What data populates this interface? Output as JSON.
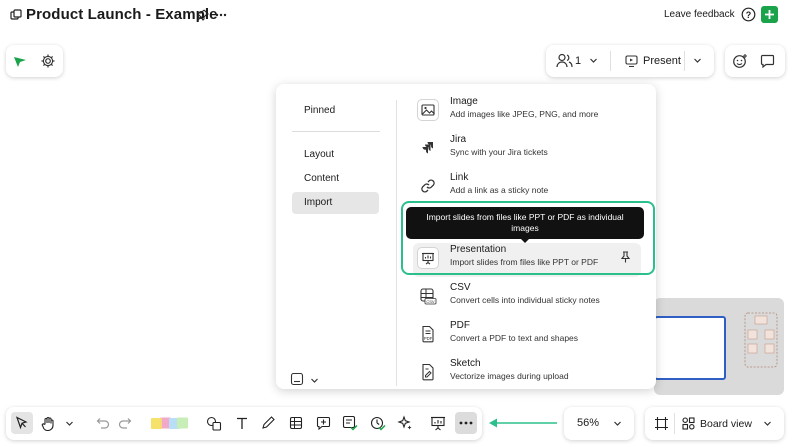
{
  "header": {
    "title": "Product Launch - Example",
    "leave_feedback": "Leave feedback"
  },
  "top_right": {
    "participants_count": "1",
    "present_label": "Present"
  },
  "menu": {
    "categories": [
      {
        "label": "Pinned"
      },
      {
        "label": "Layout"
      },
      {
        "label": "Content"
      },
      {
        "label": "Import",
        "active": true
      }
    ],
    "items": [
      {
        "title": "Image",
        "description": "Add images like JPEG, PNG, and more",
        "icon": "image-icon"
      },
      {
        "title": "Jira",
        "description": "Sync with your Jira tickets",
        "icon": "jira-icon"
      },
      {
        "title": "Link",
        "description": "Add a link as a sticky note",
        "icon": "link-icon"
      },
      {
        "title": "Presentation",
        "description": "Import slides from files like PPT or PDF",
        "icon": "presentation-icon"
      },
      {
        "title": "CSV",
        "description": "Convert cells into individual sticky notes",
        "icon": "csv-icon"
      },
      {
        "title": "PDF",
        "description": "Convert a PDF to text and shapes",
        "icon": "pdf-icon"
      },
      {
        "title": "Sketch",
        "description": "Vectorize images during upload",
        "icon": "sketch-icon"
      }
    ],
    "tooltip": "Import slides from files like PPT or PDF as individual images"
  },
  "zoom": {
    "value": "56%"
  },
  "board_view": {
    "label": "Board view"
  },
  "colors": {
    "accent_green": "#1aa34a",
    "highlight_green": "#2bc08b"
  }
}
